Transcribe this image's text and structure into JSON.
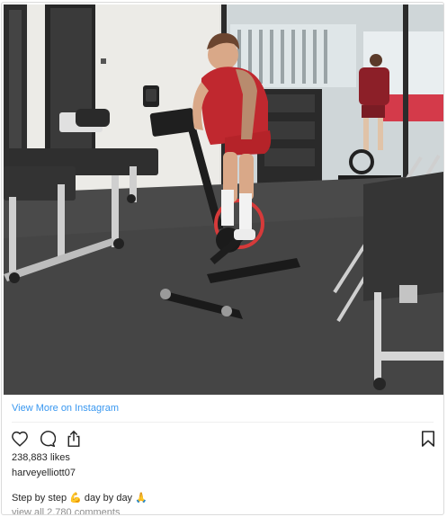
{
  "post": {
    "view_more_label": "View More on Instagram",
    "likes_text": "238,883 likes",
    "username": "harveyelliott07",
    "caption": {
      "part1": "Step by step",
      "emoji1": "💪",
      "part2": "day by day",
      "emoji2": "🙏"
    },
    "comments_link": "view all 2,780 comments"
  },
  "icons": {
    "like": "heart-icon",
    "comment": "comment-icon",
    "share": "share-icon",
    "save": "bookmark-icon"
  },
  "colors": {
    "link_blue": "#3897f0",
    "text": "#262626",
    "muted": "#8e8e8e",
    "border": "#dbdbdb"
  }
}
